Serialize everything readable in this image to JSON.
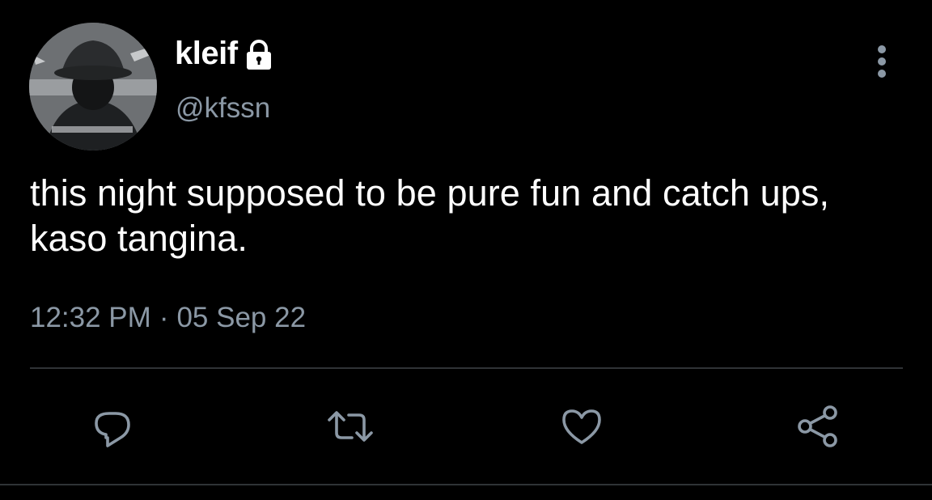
{
  "tweet": {
    "display_name": "kleif",
    "handle": "@kfssn",
    "text": "this night supposed to be pure fun and catch ups, kaso tangina.",
    "time": "12:32 PM",
    "separator": "·",
    "date": "05 Sep 22"
  },
  "icons": {
    "protected": "lock-icon",
    "more": "more-vertical-icon",
    "reply": "reply-icon",
    "retweet": "retweet-icon",
    "like": "heart-icon",
    "share": "share-icon"
  },
  "colors": {
    "background": "#000000",
    "primary_text": "#ffffff",
    "secondary_text": "#8b98a5",
    "divider": "#2f3336"
  }
}
